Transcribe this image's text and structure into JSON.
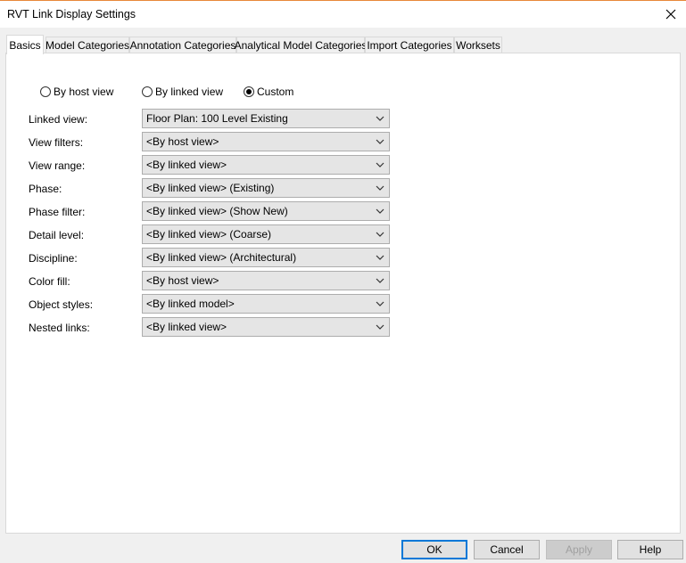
{
  "window": {
    "title": "RVT Link Display Settings",
    "close_icon": "close-icon"
  },
  "tabs": [
    {
      "label": "Basics",
      "active": true
    },
    {
      "label": "Model Categories"
    },
    {
      "label": "Annotation Categories"
    },
    {
      "label": "Analytical Model Categories"
    },
    {
      "label": "Import Categories"
    },
    {
      "label": "Worksets"
    }
  ],
  "radio_options": [
    {
      "label": "By host view",
      "selected": false
    },
    {
      "label": "By linked view",
      "selected": false
    },
    {
      "label": "Custom",
      "selected": true
    }
  ],
  "settings": [
    {
      "label": "Linked view:",
      "value": "Floor Plan: 100 Level Existing"
    },
    {
      "label": "View filters:",
      "value": "<By host view>"
    },
    {
      "label": "View range:",
      "value": "<By linked view>"
    },
    {
      "label": "Phase:",
      "value": "<By linked view> (Existing)"
    },
    {
      "label": "Phase filter:",
      "value": "<By linked view> (Show New)"
    },
    {
      "label": "Detail level:",
      "value": "<By linked view> (Coarse)"
    },
    {
      "label": "Discipline:",
      "value": "<By linked view> (Architectural)"
    },
    {
      "label": "Color fill:",
      "value": "<By host view>"
    },
    {
      "label": "Object styles:",
      "value": "<By linked model>"
    },
    {
      "label": "Nested links:",
      "value": "<By linked view>"
    }
  ],
  "buttons": {
    "ok": "OK",
    "cancel": "Cancel",
    "apply": "Apply",
    "help": "Help"
  },
  "colors": {
    "accent": "#0078d7",
    "title_border": "#e8883a"
  }
}
